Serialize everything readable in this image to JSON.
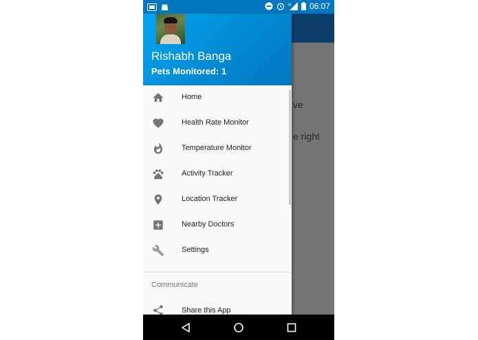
{
  "status_bar": {
    "left_icons": [
      "screenshot-icon",
      "android-icon"
    ],
    "right_icons": [
      "do-not-disturb-icon",
      "alarm-icon",
      "signal-h-icon",
      "battery-icon"
    ],
    "time": "06:07"
  },
  "drawer": {
    "header": {
      "user_name": "Rishabh Banga",
      "pets_monitored": "Pets Monitored: 1"
    },
    "items": [
      {
        "label": "Home",
        "icon": "home-icon"
      },
      {
        "label": "Health Rate Monitor",
        "icon": "heart-icon"
      },
      {
        "label": "Temperature Monitor",
        "icon": "flame-icon"
      },
      {
        "label": "Activity Tracker",
        "icon": "paw-icon"
      },
      {
        "label": "Location Tracker",
        "icon": "location-pin-icon"
      },
      {
        "label": "Nearby Doctors",
        "icon": "medical-plus-icon"
      },
      {
        "label": "Settings",
        "icon": "wrench-icon"
      }
    ],
    "section_title": "Communicate",
    "share": {
      "label": "Share this App",
      "icon": "share-icon"
    }
  },
  "background_content": {
    "line1": "ve",
    "line2": "e right"
  },
  "colors": {
    "header_start": "#03a9f4",
    "header_end": "#0277bd",
    "status_bar": "#0277bd",
    "app_bar": "#0d3d6b",
    "scrim": "#757575",
    "icon": "#757575"
  },
  "nav_bar": [
    "back-icon",
    "home-circle-icon",
    "recents-icon"
  ]
}
